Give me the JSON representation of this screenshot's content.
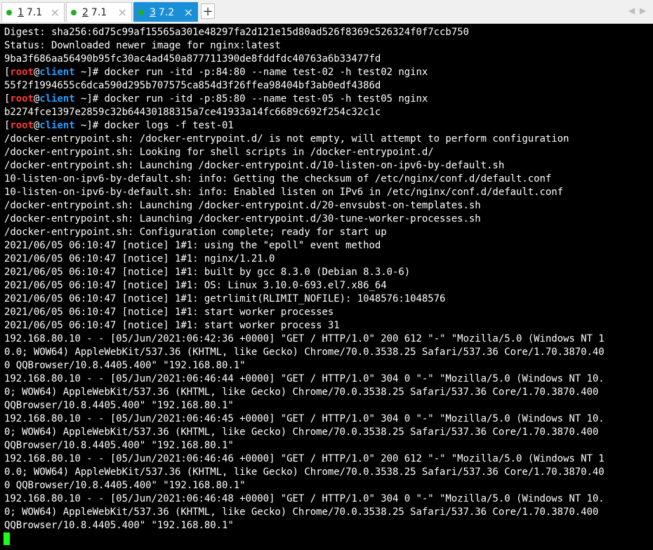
{
  "tabs": [
    {
      "num": "1",
      "label": "7.1"
    },
    {
      "num": "2",
      "label": "7.1"
    },
    {
      "num": "3",
      "label": "7.2"
    }
  ],
  "new_tab_label": "+",
  "nav_left": "◀",
  "nav_right": "▶",
  "prompt": {
    "open": "[",
    "user": "root",
    "at": "@",
    "host": "client",
    "dir": " ~]#"
  },
  "lines": [
    {
      "t": "Digest: sha256:6d75c99af15565a301e48297fa2d121e15d80ad526f8369c526324f0f7ccb750"
    },
    {
      "t": "Status: Downloaded newer image for nginx:latest"
    },
    {
      "t": "9ba3f686aa56490b95fc30ac4ad450a877711390de8fddfdc40763a6b33477fd"
    },
    {
      "prompt": true,
      "t": " docker run -itd -p:84:80 --name test-02 -h test02 nginx"
    },
    {
      "t": "55f2f1994655c6dca590d295b707575ca854d3f26ffea98404bf3ab0edf4386d"
    },
    {
      "prompt": true,
      "t": " docker run -itd -p:85:80 --name test-05 -h test05 nginx"
    },
    {
      "t": "b2274fce1397e2859c32b64430188315a7ce41933a14fc6689c692f254c32c1c"
    },
    {
      "prompt": true,
      "t": " docker logs -f test-01"
    },
    {
      "t": "/docker-entrypoint.sh: /docker-entrypoint.d/ is not empty, will attempt to perform configuration"
    },
    {
      "t": "/docker-entrypoint.sh: Looking for shell scripts in /docker-entrypoint.d/"
    },
    {
      "t": "/docker-entrypoint.sh: Launching /docker-entrypoint.d/10-listen-on-ipv6-by-default.sh"
    },
    {
      "t": "10-listen-on-ipv6-by-default.sh: info: Getting the checksum of /etc/nginx/conf.d/default.conf"
    },
    {
      "t": "10-listen-on-ipv6-by-default.sh: info: Enabled listen on IPv6 in /etc/nginx/conf.d/default.conf"
    },
    {
      "t": "/docker-entrypoint.sh: Launching /docker-entrypoint.d/20-envsubst-on-templates.sh"
    },
    {
      "t": "/docker-entrypoint.sh: Launching /docker-entrypoint.d/30-tune-worker-processes.sh"
    },
    {
      "t": "/docker-entrypoint.sh: Configuration complete; ready for start up"
    },
    {
      "t": "2021/06/05 06:10:47 [notice] 1#1: using the \"epoll\" event method"
    },
    {
      "t": "2021/06/05 06:10:47 [notice] 1#1: nginx/1.21.0"
    },
    {
      "t": "2021/06/05 06:10:47 [notice] 1#1: built by gcc 8.3.0 (Debian 8.3.0-6)"
    },
    {
      "t": "2021/06/05 06:10:47 [notice] 1#1: OS: Linux 3.10.0-693.el7.x86_64"
    },
    {
      "t": "2021/06/05 06:10:47 [notice] 1#1: getrlimit(RLIMIT_NOFILE): 1048576:1048576"
    },
    {
      "t": "2021/06/05 06:10:47 [notice] 1#1: start worker processes"
    },
    {
      "t": "2021/06/05 06:10:47 [notice] 1#1: start worker process 31"
    },
    {
      "t": "192.168.80.10 - - [05/Jun/2021:06:42:36 +0000] \"GET / HTTP/1.0\" 200 612 \"-\" \"Mozilla/5.0 (Windows NT 1"
    },
    {
      "t": "0.0; WOW64) AppleWebKit/537.36 (KHTML, like Gecko) Chrome/70.0.3538.25 Safari/537.36 Core/1.70.3870.40"
    },
    {
      "t": "0 QQBrowser/10.8.4405.400\" \"192.168.80.1\""
    },
    {
      "t": "192.168.80.10 - - [05/Jun/2021:06:46:44 +0000] \"GET / HTTP/1.0\" 304 0 \"-\" \"Mozilla/5.0 (Windows NT 10."
    },
    {
      "t": "0; WOW64) AppleWebKit/537.36 (KHTML, like Gecko) Chrome/70.0.3538.25 Safari/537.36 Core/1.70.3870.400"
    },
    {
      "t": "QQBrowser/10.8.4405.400\" \"192.168.80.1\""
    },
    {
      "t": "192.168.80.10 - - [05/Jun/2021:06:46:45 +0000] \"GET / HTTP/1.0\" 304 0 \"-\" \"Mozilla/5.0 (Windows NT 10."
    },
    {
      "t": "0; WOW64) AppleWebKit/537.36 (KHTML, like Gecko) Chrome/70.0.3538.25 Safari/537.36 Core/1.70.3870.400"
    },
    {
      "t": "QQBrowser/10.8.4405.400\" \"192.168.80.1\""
    },
    {
      "t": "192.168.80.10 - - [05/Jun/2021:06:46:46 +0000] \"GET / HTTP/1.0\" 200 612 \"-\" \"Mozilla/5.0 (Windows NT 1"
    },
    {
      "t": "0.0; WOW64) AppleWebKit/537.36 (KHTML, like Gecko) Chrome/70.0.3538.25 Safari/537.36 Core/1.70.3870.40"
    },
    {
      "t": "0 QQBrowser/10.8.4405.400\" \"192.168.80.1\""
    },
    {
      "t": "192.168.80.10 - - [05/Jun/2021:06:46:48 +0000] \"GET / HTTP/1.0\" 304 0 \"-\" \"Mozilla/5.0 (Windows NT 10."
    },
    {
      "t": "0; WOW64) AppleWebKit/537.36 (KHTML, like Gecko) Chrome/70.0.3538.25 Safari/537.36 Core/1.70.3870.400"
    },
    {
      "t": "QQBrowser/10.8.4405.400\" \"192.168.80.1\""
    }
  ]
}
